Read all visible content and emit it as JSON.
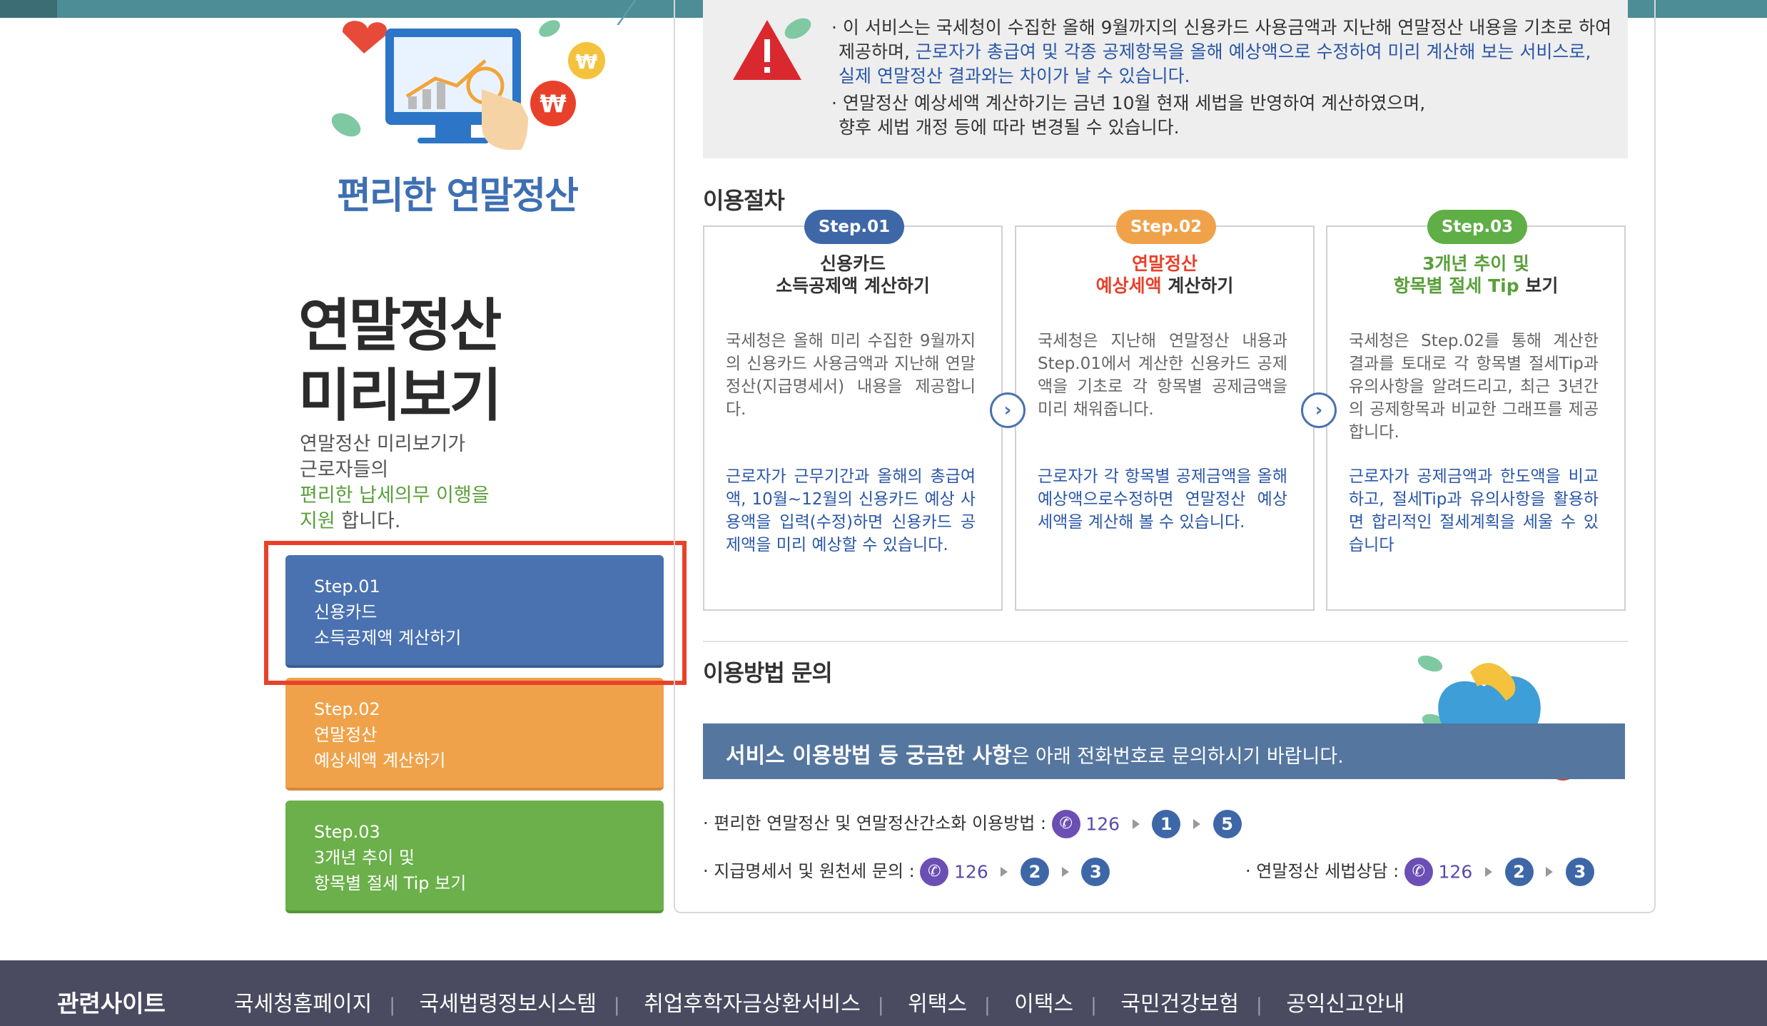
{
  "hero": {
    "title": "편리한 연말정산"
  },
  "sidebar": {
    "big_title_line1": "연말정산",
    "big_title_line2": "미리보기",
    "intro_line1": "연말정산 미리보기가",
    "intro_line2": "근로자들의",
    "intro_green1": "편리한 납세의무 이행을",
    "intro_green2": "지원",
    "intro_end": " 합니다.",
    "steps": [
      {
        "line1": "Step.01",
        "line2": "신용카드",
        "line3": "소득공제액 계산하기"
      },
      {
        "line1": "Step.02",
        "line2": "연말정산",
        "line3": "예상세액 계산하기"
      },
      {
        "line1": "Step.03",
        "line2": "3개년 추이 및",
        "line3": "항목별 절세 Tip 보기"
      }
    ]
  },
  "notice": {
    "l1": "· 이 서비스는 국세청이 수집한 올해 9월까지의 신용카드 사용금액과 지난해 연말정산 내용을 기초로 하여",
    "l2a": "제공하며, ",
    "l2b": "근로자가 총급여 및 각종 공제항목을 올해 예상액으로 수정하여 미리 계산해 보는 서비스로,",
    "l3": "실제 연말정산 결과와는 차이가 날 수 있습니다.",
    "l4": "· 연말정산 예상세액 계산하기는 금년 10월 현재 세법을 반영하여 계산하였으며,",
    "l5": "향후 세법 개정 등에 따라 변경될 수 있습니다."
  },
  "procedure": {
    "title": "이용절차",
    "cards": [
      {
        "pill": "Step.01",
        "title1": "신용카드",
        "title2": "소득공제액 계산하기",
        "desc": "국세청은 올해 미리 수집한 9월까지의 신용카드 사용금액과 지난해 연말정산(지급명세서) 내용을 제공합니다.",
        "note": "근로자가 근무기간과 올해의 총급여액, 10월~12월의 신용카드 예상 사용액을 입력(수정)하면 신용카드 공제액을 미리 예상할 수 있습니다."
      },
      {
        "pill": "Step.02",
        "title1": "연말정산",
        "title2a": "예상세액",
        "title2b": " 계산하기",
        "desc": "국세청은 지난해 연말정산 내용과 Step.01에서 계산한 신용카드 공제액을 기초로 각 항목별 공제금액을 미리 채워줍니다.",
        "note": "근로자가 각 항목별 공제금액을 올해예상액으로수정하면 연말정산 예상세액을 계산해 볼 수 있습니다."
      },
      {
        "pill": "Step.03",
        "title1": "3개년 추이 및",
        "title2a": "항목별 절세 Tip",
        "title2b": " 보기",
        "desc": "국세청은 Step.02를 통해 계산한 결과를 토대로 각 항목별 절세Tip과 유의사항을 알려드리고, 최근 3년간의 공제항목과 비교한 그래프를 제공합니다.",
        "note": "근로자가 공제금액과 한도액을 비교하고, 절세Tip과 유의사항을 활용하면 합리적인 절세계획을 세울 수 있습니다"
      }
    ],
    "arrow": "›"
  },
  "inquiry": {
    "title": "이용방법 문의",
    "banner_bold": "서비스 이용방법 등 궁금한 사항",
    "banner_rest": "은 아래 전화번호로 문의하시기 바랍니다.",
    "row1_label": "· 편리한 연말정산 및 연말정산간소화 이용방법 :",
    "row2_label": "· 지급명세서 및 원천세 문의 :",
    "row3_label": "· 연말정산 세법상담 :",
    "number": "126",
    "row1_keys": [
      "1",
      "5"
    ],
    "row2_keys": [
      "2",
      "3"
    ],
    "row3_keys": [
      "2",
      "3"
    ]
  },
  "footer": {
    "label": "관련사이트",
    "links": [
      "국세청홈페이지",
      "국세법령정보시스템",
      "취업후학자금상환서비스",
      "위택스",
      "이택스",
      "국민건강보험",
      "공익신고안내"
    ],
    "separator": "|"
  },
  "colors": {
    "step1": "#4a72b0",
    "step2": "#f0a24a",
    "step3": "#6bb04a",
    "highlight": "#e8412b",
    "footer": "#4a4b60"
  }
}
